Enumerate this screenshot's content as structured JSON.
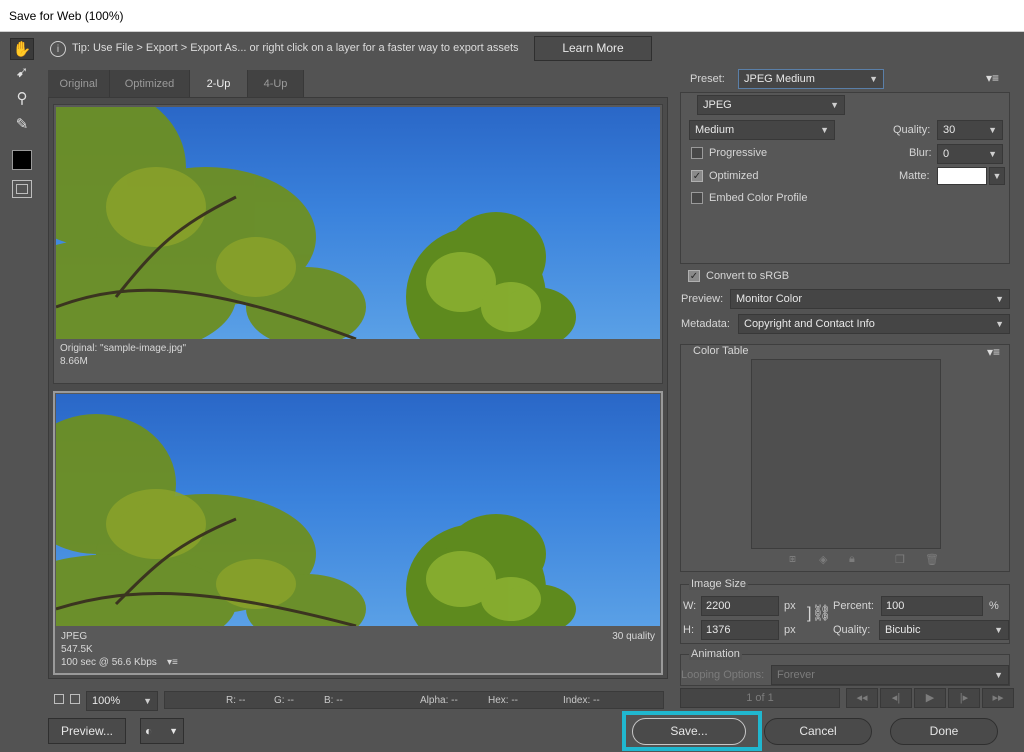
{
  "window": {
    "title": "Save for Web (100%)"
  },
  "tools": [
    {
      "name": "hand-tool-icon",
      "glyph": "✋"
    },
    {
      "name": "slice-select-tool-icon",
      "glyph": "➹"
    },
    {
      "name": "zoom-tool-icon",
      "glyph": "⚲"
    },
    {
      "name": "eyedropper-tool-icon",
      "glyph": "✎"
    }
  ],
  "tip": {
    "text": "Tip: Use File > Export > Export As...  or right click on a layer for a faster way to export assets",
    "learn_more": "Learn More"
  },
  "tabs": [
    "Original",
    "Optimized",
    "2-Up",
    "4-Up"
  ],
  "active_tab": "2-Up",
  "original_pane": {
    "line1": "Original: \"sample-image.jpg\"",
    "line2": "8.66M"
  },
  "optimized_pane": {
    "format": "JPEG",
    "size": "547.5K",
    "time": "100 sec @ 56.6 Kbps",
    "quality": "30 quality"
  },
  "statusbar": {
    "zoom": "100%",
    "r": "R: --",
    "g": "G: --",
    "b": "B: --",
    "alpha": "Alpha: --",
    "hex": "Hex: --",
    "index": "Index: --"
  },
  "settings": {
    "preset_label": "Preset:",
    "preset_value": "JPEG Medium",
    "format": "JPEG",
    "quality_level": "Medium",
    "quality_label": "Quality:",
    "quality_value": "30",
    "progressive": "Progressive",
    "blur_label": "Blur:",
    "blur_value": "0",
    "optimized": "Optimized",
    "matte_label": "Matte:",
    "embed_profile": "Embed Color Profile",
    "convert_srgb": "Convert to sRGB",
    "preview_label": "Preview:",
    "preview_value": "Monitor Color",
    "metadata_label": "Metadata:",
    "metadata_value": "Copyright and Contact Info"
  },
  "color_table": {
    "title": "Color Table"
  },
  "image_size": {
    "title": "Image Size",
    "w_label": "W:",
    "w_value": "2200",
    "h_label": "H:",
    "h_value": "1376",
    "unit": "px",
    "percent_label": "Percent:",
    "percent_value": "100",
    "percent_unit": "%",
    "quality_label": "Quality:",
    "quality_value": "Bicubic"
  },
  "animation": {
    "title": "Animation",
    "looping_label": "Looping Options:",
    "looping_value": "Forever",
    "frame": "1 of 1"
  },
  "buttons": {
    "preview": "Preview...",
    "save": "Save...",
    "cancel": "Cancel",
    "done": "Done"
  },
  "colors": {
    "highlight": "#20b7cf",
    "panel": "#535353",
    "sky": "#2f74d0"
  }
}
